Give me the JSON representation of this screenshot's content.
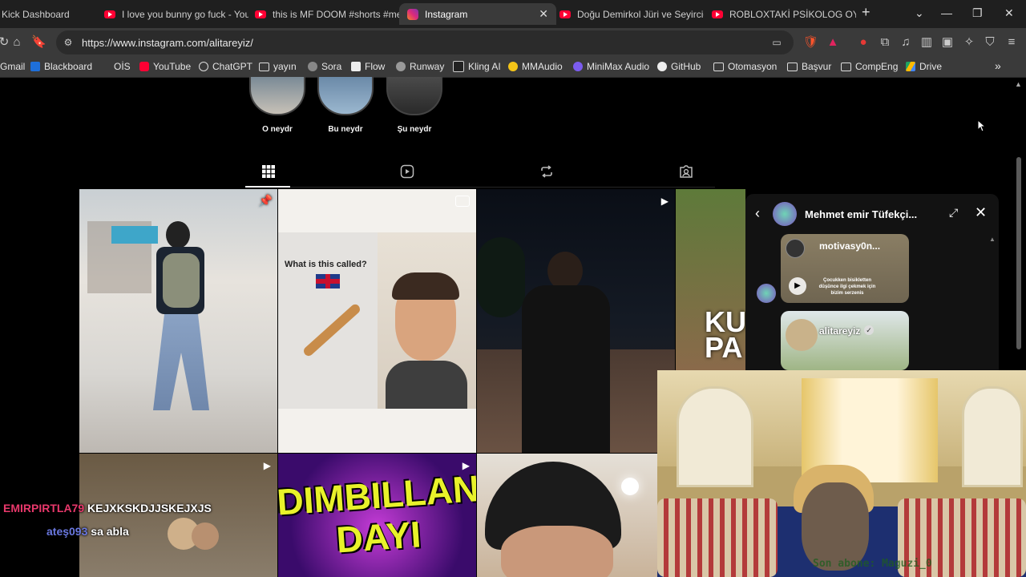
{
  "tabs": [
    {
      "title": "Kick Dashboard",
      "icon": "kick-icon"
    },
    {
      "title": "I love you bunny go fuck - YouT",
      "icon": "youtube-icon"
    },
    {
      "title": "this is MF DOOM #shorts #me",
      "icon": "youtube-icon"
    },
    {
      "title": "Instagram",
      "icon": "instagram-icon",
      "active": true
    },
    {
      "title": "Doğu Demirkol Jüri ve Seyircid",
      "icon": "youtube-icon"
    },
    {
      "title": "ROBLOXTAKİ PSİKOLOG OYUNU",
      "icon": "youtube-icon"
    }
  ],
  "new_tab": "+",
  "url": "https://www.instagram.com/alitareyiz/",
  "bookmarks": [
    {
      "label": "Gmail"
    },
    {
      "label": "Blackboard"
    },
    {
      "label": "OİS"
    },
    {
      "label": "YouTube"
    },
    {
      "label": "ChatGPT"
    },
    {
      "label": "yayın"
    },
    {
      "label": "Sora"
    },
    {
      "label": "Flow"
    },
    {
      "label": "Runway"
    },
    {
      "label": "Kling AI"
    },
    {
      "label": "MMAudio"
    },
    {
      "label": "MiniMax Audio"
    },
    {
      "label": "GitHub"
    },
    {
      "label": "Otomasyon"
    },
    {
      "label": "Başvur"
    },
    {
      "label": "CompEng"
    },
    {
      "label": "Drive"
    }
  ],
  "highlights": [
    {
      "label": "O neydr"
    },
    {
      "label": "Bu neydr"
    },
    {
      "label": "Şu neydr"
    }
  ],
  "profile_tabs": [
    "grid-icon",
    "reels-icon",
    "reposts-icon",
    "tagged-icon"
  ],
  "posts": {
    "post2_text": "What is this called?",
    "post5_text": "DIMBILLAN DAYI",
    "post4_text": "KU PA"
  },
  "chat": {
    "name": "Mehmet emir Tüfekçi...",
    "msg1_account": "motivasy0n...",
    "msg1_caption": "Çocukken bisikletten düşünce ilgi çekmek için bizim serzenis",
    "msg2_account": "alitareyiz"
  },
  "stream_chat": [
    {
      "user": "EMIRPIRTLA79",
      "message": "KEJXKSKDJJSKEJXJS",
      "color": "#e8386b"
    },
    {
      "user": "ateş093",
      "message": "sa abla",
      "color": "#6a78e0"
    }
  ],
  "stream_footer": "Son abone: Maguzi_0"
}
